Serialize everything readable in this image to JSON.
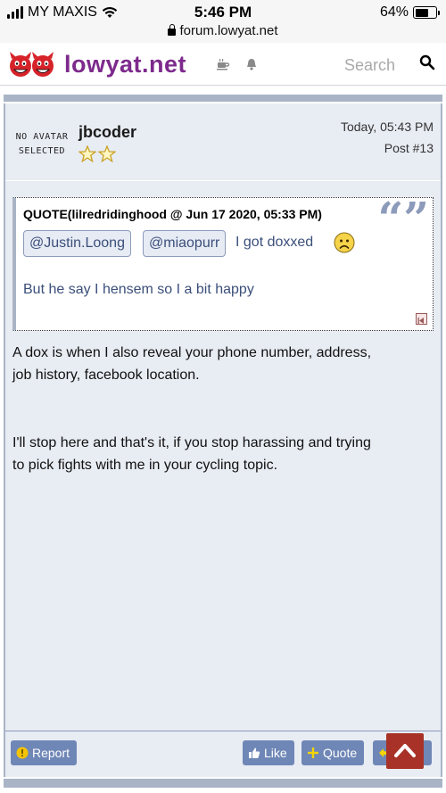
{
  "status_bar": {
    "carrier": "MY MAXIS",
    "time": "5:46 PM",
    "battery_percent": "64%",
    "battery_level": 0.64
  },
  "url_bar": {
    "url": "forum.lowyat.net"
  },
  "header": {
    "site_name": "lowyat.net",
    "search_placeholder": "Search",
    "icons": [
      "coffee-icon",
      "bell-icon",
      "search-icon"
    ]
  },
  "post": {
    "avatar_text_line1": "NO AVATAR",
    "avatar_text_line2": "SELECTED",
    "username": "jbcoder",
    "rank_stars": 2,
    "timestamp": "Today, 05:43 PM",
    "post_number": "Post #13",
    "quote": {
      "header": "QUOTE(lilredridinghood @ Jun 17 2020, 05:33 PM)",
      "mention1": "@Justin.Loong",
      "mention2": "@miaopurr",
      "line1": "I got doxxed",
      "line2": "But he say I hensem so I a bit happy"
    },
    "body": {
      "para1_line1": "A dox is when I also reveal your phone number, address,",
      "para1_line2": "job history, facebook location.",
      "para2_line1": "I'll stop here and that's it, if you stop harassing and trying",
      "para2_line2": "to pick fights with me in your cycling topic."
    },
    "actions": {
      "report": "Report",
      "like": "Like",
      "quote": "Quote"
    }
  },
  "colors": {
    "brand_purple": "#7d2a8c",
    "logo_red": "#d6232a",
    "post_bg": "#e8ecf3",
    "button_blue": "#6f87b6",
    "back_to_top": "#a83227"
  }
}
